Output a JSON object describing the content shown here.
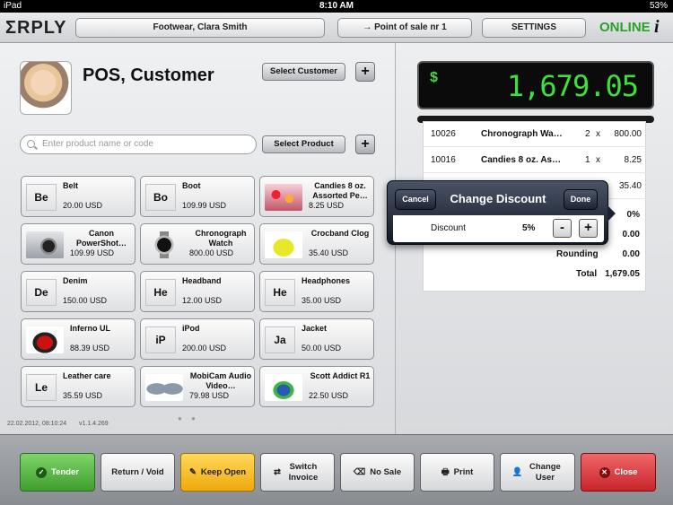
{
  "status_bar": {
    "carrier": "iPad",
    "time": "8:10 AM",
    "battery": "53%"
  },
  "header": {
    "logo": "ΣRPLY",
    "location_label": "Footwear, Clara Smith",
    "pos_label": "→  Point of sale nr 1",
    "settings_label": "SETTINGS",
    "status": "ONLINE",
    "info_label": "i"
  },
  "customer": {
    "name": "POS, Customer",
    "select_customer_label": "Select Customer",
    "add_label": "+"
  },
  "search": {
    "placeholder": "Enter product name or code",
    "select_product_label": "Select Product",
    "add_label": "+"
  },
  "products": [
    {
      "name": "Belt",
      "price": "20.00 USD",
      "thumb": "Be"
    },
    {
      "name": "Boot",
      "price": "109.99 USD",
      "thumb": "Bo"
    },
    {
      "name": "Candies 8 oz. Assorted Pe…",
      "price": "8.25 USD",
      "thumb": ""
    },
    {
      "name": "Canon PowerShot…",
      "price": "109.99 USD",
      "thumb": ""
    },
    {
      "name": "Chronograph Watch",
      "price": "800.00 USD",
      "thumb": ""
    },
    {
      "name": "Crocband Clog",
      "price": "35.40 USD",
      "thumb": ""
    },
    {
      "name": "Denim",
      "price": "150.00 USD",
      "thumb": "De"
    },
    {
      "name": "Headband",
      "price": "12.00 USD",
      "thumb": "He"
    },
    {
      "name": "Headphones",
      "price": "35.00 USD",
      "thumb": "He"
    },
    {
      "name": "Inferno UL",
      "price": "88.39 USD",
      "thumb": ""
    },
    {
      "name": "iPod",
      "price": "200.00 USD",
      "thumb": "iP"
    },
    {
      "name": "Jacket",
      "price": "50.00 USD",
      "thumb": "Ja"
    },
    {
      "name": "Leather care",
      "price": "35.59 USD",
      "thumb": "Le"
    },
    {
      "name": "MobiCam Audio Video…",
      "price": "79.98 USD",
      "thumb": ""
    },
    {
      "name": "Scott Addict R1",
      "price": "22.50 USD",
      "thumb": ""
    }
  ],
  "footer_info": {
    "timestamp": "22.02.2012, 08:10:24",
    "version": "v1.1.4.269"
  },
  "display": {
    "currency": "$",
    "amount": "1,679.05"
  },
  "receipt": {
    "lines": [
      {
        "code": "10026",
        "name": "Chronograph Wa…",
        "qty": "2",
        "x": "x",
        "total": "800.00"
      },
      {
        "code": "10016",
        "name": "Candies 8 oz. As…",
        "qty": "1",
        "x": "x",
        "total": "8.25"
      },
      {
        "total": "35.40"
      }
    ],
    "discount_value": "0%",
    "subtotal_value": "0.00",
    "tax_value": "0.00",
    "rounding_label": "Rounding",
    "rounding_value": "0.00",
    "total_label": "Total",
    "total_value": "1,679.05"
  },
  "popover": {
    "cancel_label": "Cancel",
    "title": "Change Discount",
    "done_label": "Done",
    "discount_label": "Discount",
    "discount_value": "5%",
    "minus_label": "-",
    "plus_label": "+"
  },
  "actions": {
    "tender": "Tender",
    "return_void": "Return / Void",
    "keep_open": "Keep Open",
    "switch_invoice": "Switch Invoice",
    "no_sale": "No Sale",
    "print": "Print",
    "change_user": "Change User",
    "close": "Close"
  },
  "colors": {
    "online": "#2aa12a",
    "display_digits": "#3de03d",
    "tender": "#4caf36",
    "keep_open": "#f5b51c",
    "close": "#d9343a"
  }
}
